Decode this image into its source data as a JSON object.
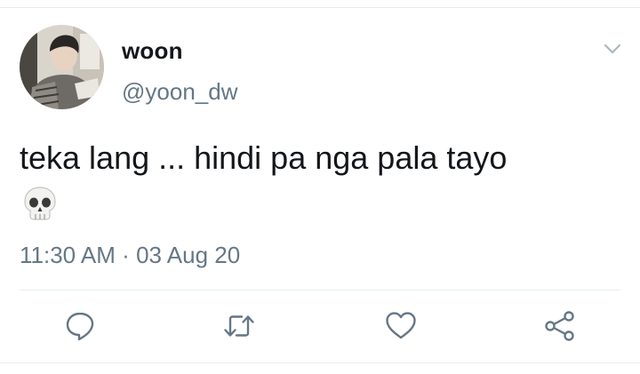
{
  "tweet": {
    "author": {
      "display_name": "woon",
      "handle": "@yoon_dw"
    },
    "text": "teka lang ... hindi pa nga pala tayo",
    "emoji": "skull-emoji",
    "time": "11:30 AM",
    "separator": "·",
    "date": "03 Aug 20"
  },
  "icons": {
    "menu": "chevron-down-icon",
    "reply": "reply-icon",
    "retweet": "retweet-icon",
    "like": "heart-icon",
    "share": "share-icon"
  },
  "colors": {
    "text": "#14171a",
    "secondary": "#657786",
    "divider": "#e6ecf0"
  }
}
